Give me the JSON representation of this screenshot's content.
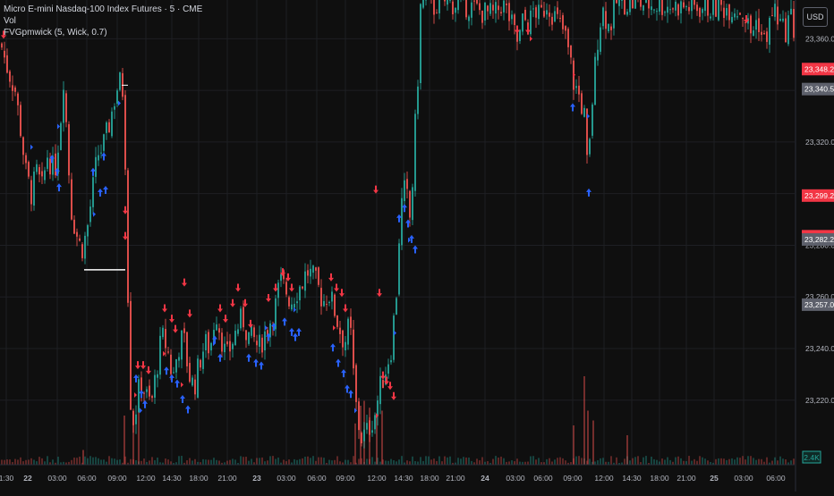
{
  "header": {
    "title": "Micro E-mini Nasdaq-100 Index Futures · 5 · CME",
    "indicator_vol": "Vol",
    "indicator_fvg": "FVGpmwick (5, Wick, 0.7)"
  },
  "currency_button": "USD",
  "colors": {
    "background": "#0f0f0f",
    "grid": "#1e1f23",
    "up": "#26a69a",
    "down": "#ef5350",
    "up_arrow": "#2962ff",
    "down_arrow": "#f23645",
    "level_line": "#ffffff",
    "axis_text": "#b2b5be",
    "badge_red": "#f23645",
    "badge_gray": "#5d606b",
    "badge_green_border": "#26a69a"
  },
  "chart_data": {
    "type": "candlestick",
    "instrument": "Micro E-mini Nasdaq-100 Index Futures",
    "timeframe": "5",
    "exchange": "CME",
    "ylim": [
      23195,
      23375
    ],
    "y_ticks": [
      "23,360.00",
      "23,340.00",
      "23,320.00",
      "23,300.00",
      "23,280.00",
      "23,260.00",
      "23,240.00",
      "23,220.00"
    ],
    "x_ticks": [
      "1:30",
      "22",
      "03:00",
      "06:00",
      "09:00",
      "12:00",
      "14:30",
      "18:00",
      "21:00",
      "23",
      "03:00",
      "06:00",
      "09:00",
      "12:00",
      "14:30",
      "18:00",
      "21:00",
      "24",
      "03:00",
      "06:00",
      "09:00",
      "12:00",
      "14:30",
      "18:00",
      "21:00",
      "25",
      "03:00",
      "06:00"
    ],
    "price_badges": [
      {
        "label": "23,348.25",
        "value": 23348.25,
        "style": "red"
      },
      {
        "label": "23,340.50",
        "value": 23340.5,
        "style": "gray"
      },
      {
        "label": "23,299.25",
        "value": 23299.25,
        "style": "red"
      },
      {
        "label": "23,283.50",
        "value": 23283.5,
        "style": "red"
      },
      {
        "label": "23,282.25",
        "value": 23282.25,
        "style": "gray"
      },
      {
        "label": "23,257.00",
        "value": 23257,
        "style": "gray"
      }
    ],
    "volume_badge": "2.4K",
    "levels": [
      {
        "value": 23270.5,
        "label": ""
      }
    ],
    "series_path": [
      [
        0,
        23358
      ],
      [
        6,
        23350
      ],
      [
        16,
        23340
      ],
      [
        22,
        23325
      ],
      [
        28,
        23308
      ],
      [
        34,
        23300
      ],
      [
        40,
        23308
      ],
      [
        46,
        23302
      ],
      [
        52,
        23315
      ],
      [
        60,
        23308
      ],
      [
        66,
        23325
      ],
      [
        70,
        23345
      ],
      [
        74,
        23322
      ],
      [
        78,
        23295
      ],
      [
        84,
        23285
      ],
      [
        90,
        23278
      ],
      [
        96,
        23285
      ],
      [
        102,
        23300
      ],
      [
        108,
        23315
      ],
      [
        114,
        23318
      ],
      [
        120,
        23325
      ],
      [
        126,
        23335
      ],
      [
        132,
        23344
      ],
      [
        136,
        23340
      ],
      [
        140,
        23305
      ],
      [
        143,
        23240
      ],
      [
        146,
        23210
      ],
      [
        150,
        23215
      ],
      [
        156,
        23228
      ],
      [
        162,
        23222
      ],
      [
        168,
        23218
      ],
      [
        174,
        23232
      ],
      [
        180,
        23245
      ],
      [
        186,
        23240
      ],
      [
        192,
        23228
      ],
      [
        198,
        23240
      ],
      [
        204,
        23245
      ],
      [
        210,
        23230
      ],
      [
        216,
        23225
      ],
      [
        222,
        23235
      ],
      [
        228,
        23242
      ],
      [
        234,
        23240
      ],
      [
        240,
        23255
      ],
      [
        246,
        23245
      ],
      [
        252,
        23236
      ],
      [
        258,
        23242
      ],
      [
        264,
        23248
      ],
      [
        270,
        23252
      ],
      [
        276,
        23245
      ],
      [
        282,
        23244
      ],
      [
        288,
        23240
      ],
      [
        294,
        23245
      ],
      [
        300,
        23250
      ],
      [
        306,
        23255
      ],
      [
        312,
        23266
      ],
      [
        318,
        23263
      ],
      [
        324,
        23258
      ],
      [
        330,
        23262
      ],
      [
        336,
        23265
      ],
      [
        342,
        23270
      ],
      [
        348,
        23268
      ],
      [
        354,
        23264
      ],
      [
        360,
        23258
      ],
      [
        366,
        23262
      ],
      [
        372,
        23256
      ],
      [
        378,
        23248
      ],
      [
        384,
        23242
      ],
      [
        390,
        23250
      ],
      [
        396,
        23220
      ],
      [
        402,
        23205
      ],
      [
        410,
        23208
      ],
      [
        418,
        23215
      ],
      [
        424,
        23225
      ],
      [
        430,
        23232
      ],
      [
        436,
        23240
      ],
      [
        442,
        23262
      ],
      [
        446,
        23290
      ],
      [
        450,
        23302
      ],
      [
        454,
        23298
      ],
      [
        458,
        23288
      ],
      [
        462,
        23320
      ],
      [
        466,
        23345
      ],
      [
        469,
        23372
      ],
      [
        472,
        23375
      ],
      [
        478,
        23374
      ],
      [
        484,
        23372
      ],
      [
        490,
        23375
      ],
      [
        500,
        23374
      ],
      [
        520,
        23373
      ],
      [
        540,
        23370
      ],
      [
        552,
        23369
      ],
      [
        560,
        23374
      ],
      [
        566,
        23370
      ],
      [
        572,
        23364
      ],
      [
        578,
        23358
      ],
      [
        584,
        23368
      ],
      [
        590,
        23365
      ],
      [
        596,
        23372
      ],
      [
        602,
        23368
      ],
      [
        610,
        23374
      ],
      [
        620,
        23368
      ],
      [
        630,
        23362
      ],
      [
        636,
        23352
      ],
      [
        640,
        23343
      ],
      [
        646,
        23338
      ],
      [
        652,
        23330
      ],
      [
        656,
        23305
      ],
      [
        660,
        23332
      ],
      [
        666,
        23358
      ],
      [
        672,
        23372
      ],
      [
        680,
        23364
      ],
      [
        688,
        23374
      ],
      [
        700,
        23374
      ],
      [
        740,
        23373
      ],
      [
        780,
        23372
      ],
      [
        820,
        23372
      ],
      [
        830,
        23370
      ],
      [
        838,
        23362
      ],
      [
        846,
        23368
      ],
      [
        852,
        23358
      ],
      [
        858,
        23364
      ],
      [
        864,
        23372
      ],
      [
        870,
        23366
      ],
      [
        876,
        23362
      ],
      [
        882,
        23370
      ],
      [
        888,
        23360
      ]
    ],
    "up_signals": [
      [
        58,
        23315
      ],
      [
        64,
        23310
      ],
      [
        66,
        23304
      ],
      [
        104,
        23310
      ],
      [
        116,
        23316
      ],
      [
        112,
        23302
      ],
      [
        118,
        23303
      ],
      [
        152,
        23230
      ],
      [
        158,
        23224
      ],
      [
        162,
        23220
      ],
      [
        186,
        23233
      ],
      [
        192,
        23230
      ],
      [
        198,
        23228
      ],
      [
        204,
        23222
      ],
      [
        210,
        23218
      ],
      [
        240,
        23245
      ],
      [
        246,
        23238
      ],
      [
        278,
        23238
      ],
      [
        286,
        23236
      ],
      [
        292,
        23235
      ],
      [
        300,
        23246
      ],
      [
        306,
        23250
      ],
      [
        318,
        23252
      ],
      [
        326,
        23248
      ],
      [
        330,
        23246
      ],
      [
        334,
        23248
      ],
      [
        372,
        23242
      ],
      [
        378,
        23236
      ],
      [
        384,
        23232
      ],
      [
        388,
        23226
      ],
      [
        392,
        23224
      ],
      [
        446,
        23292
      ],
      [
        452,
        23296
      ],
      [
        456,
        23290
      ],
      [
        460,
        23284
      ],
      [
        464,
        23280
      ],
      [
        640,
        23335
      ],
      [
        658,
        23302
      ]
    ],
    "down_signals": [
      [
        4,
        23360
      ],
      [
        140,
        23292
      ],
      [
        140,
        23282
      ],
      [
        154,
        23232
      ],
      [
        160,
        23232
      ],
      [
        166,
        23230
      ],
      [
        184,
        23254
      ],
      [
        192,
        23250
      ],
      [
        196,
        23246
      ],
      [
        206,
        23264
      ],
      [
        212,
        23252
      ],
      [
        246,
        23254
      ],
      [
        252,
        23250
      ],
      [
        260,
        23256
      ],
      [
        266,
        23262
      ],
      [
        274,
        23256
      ],
      [
        280,
        23248
      ],
      [
        300,
        23258
      ],
      [
        308,
        23262
      ],
      [
        316,
        23268
      ],
      [
        322,
        23266
      ],
      [
        326,
        23262
      ],
      [
        370,
        23266
      ],
      [
        376,
        23262
      ],
      [
        382,
        23260
      ],
      [
        386,
        23254
      ],
      [
        420,
        23300
      ],
      [
        424,
        23260
      ],
      [
        428,
        23228
      ],
      [
        432,
        23226
      ],
      [
        436,
        23224
      ],
      [
        440,
        23220
      ],
      [
        578,
        23362
      ],
      [
        590,
        23362
      ],
      [
        834,
        23366
      ]
    ],
    "right_markers": [
      [
        34,
        23318,
        "up"
      ],
      [
        64,
        23326,
        "up"
      ],
      [
        104,
        23292,
        "up"
      ],
      [
        132,
        23335,
        "up"
      ],
      [
        150,
        23222,
        "down"
      ],
      [
        156,
        23216,
        "up"
      ],
      [
        182,
        23238,
        "down"
      ],
      [
        202,
        23226,
        "down"
      ],
      [
        238,
        23242,
        "up"
      ],
      [
        296,
        23248,
        "up"
      ],
      [
        328,
        23255,
        "up"
      ],
      [
        372,
        23248,
        "down"
      ],
      [
        396,
        23216,
        "up"
      ],
      [
        420,
        23214,
        "down"
      ],
      [
        440,
        23246,
        "up"
      ],
      [
        456,
        23282,
        "up"
      ],
      [
        592,
        23360,
        "down"
      ],
      [
        640,
        23346,
        "down"
      ],
      [
        656,
        23330,
        "up"
      ]
    ],
    "volume_spikes": [
      [
        92,
        0.15
      ],
      [
        138,
        0.5
      ],
      [
        148,
        0.55
      ],
      [
        154,
        0.6
      ],
      [
        396,
        0.42
      ],
      [
        402,
        0.6
      ],
      [
        406,
        0.65
      ],
      [
        412,
        0.58
      ],
      [
        420,
        0.5
      ],
      [
        426,
        0.55
      ],
      [
        652,
        0.9
      ],
      [
        656,
        0.55
      ],
      [
        662,
        0.45
      ],
      [
        640,
        0.4
      ],
      [
        700,
        0.3
      ]
    ]
  }
}
